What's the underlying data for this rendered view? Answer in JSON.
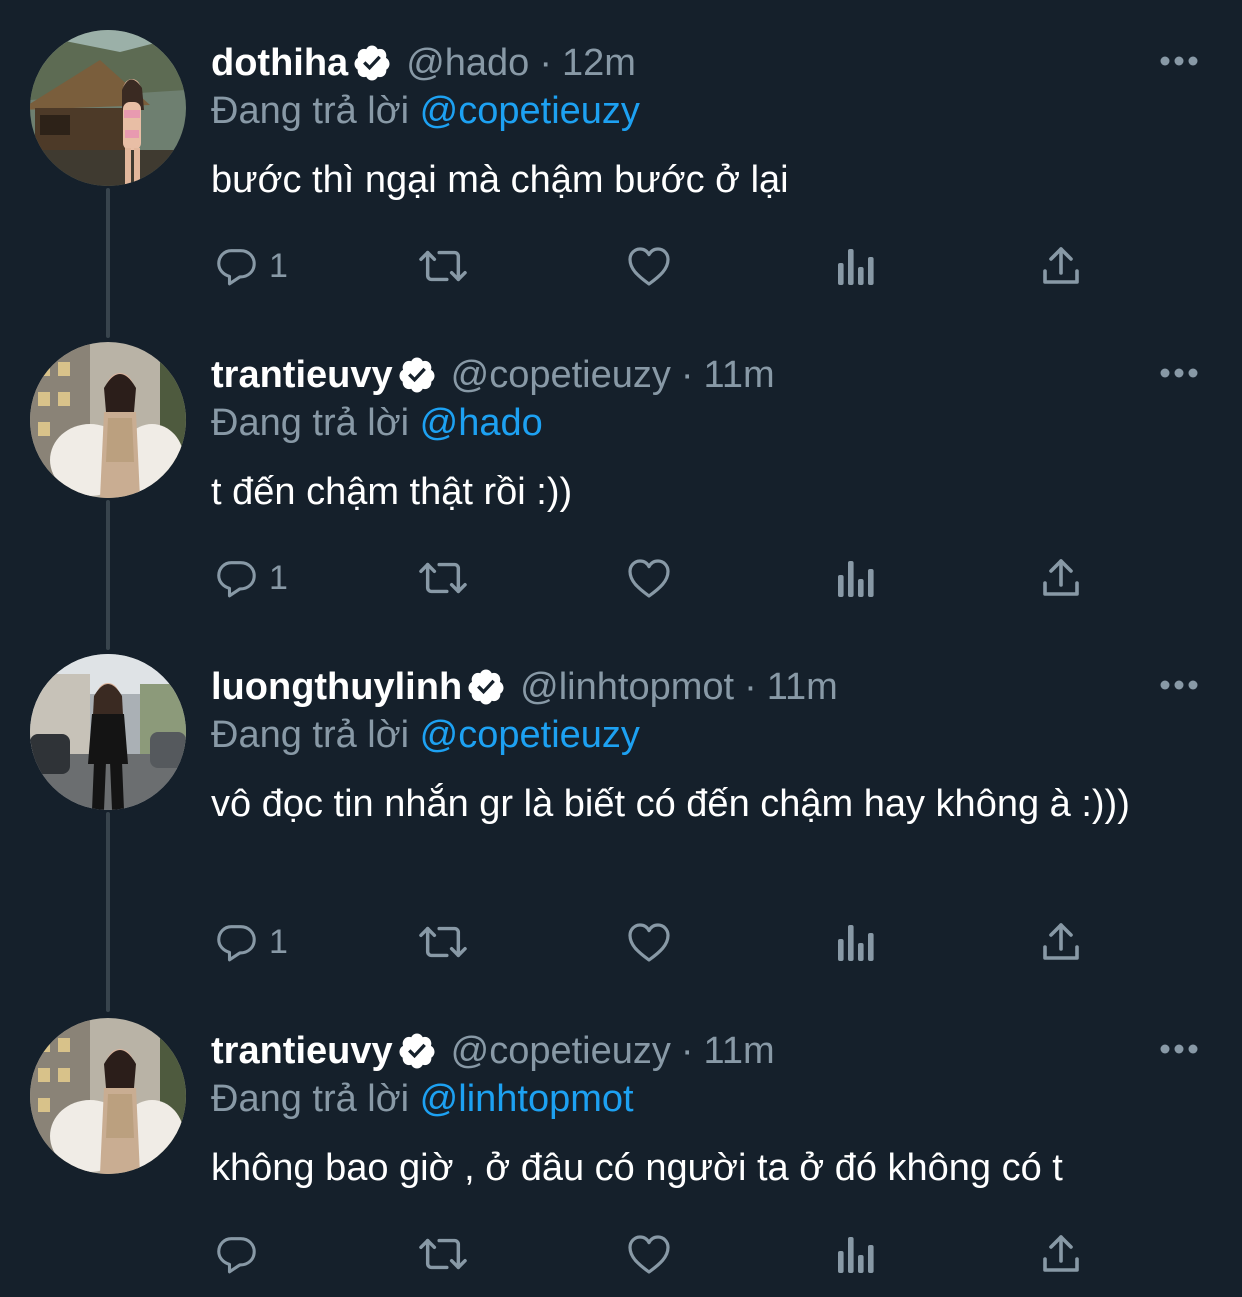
{
  "colors": {
    "background": "#15202b",
    "text_primary": "#ffffff",
    "text_secondary": "#8899a6",
    "link": "#1da1f2",
    "thread_line": "#38444d",
    "icon": "#8899a6"
  },
  "tweets": [
    {
      "display_name": "dothiha",
      "verified": true,
      "handle": "@hado",
      "separator": "·",
      "time": "12m",
      "replying_label": "Đang trả lời",
      "replying_to": "@copetieuzy",
      "text": "bước thì ngại mà chậm bước ở lại",
      "reply_count": "1",
      "icons": [
        "reply-icon",
        "retweet-icon",
        "like-icon",
        "views-icon",
        "share-icon",
        "more-icon",
        "verified-badge-icon"
      ]
    },
    {
      "display_name": "trantieuvy",
      "verified": true,
      "handle": "@copetieuzy",
      "separator": "·",
      "time": "11m",
      "replying_label": "Đang trả lời",
      "replying_to": "@hado",
      "text": "t đến chậm thật rồi :))",
      "reply_count": "1",
      "icons": [
        "reply-icon",
        "retweet-icon",
        "like-icon",
        "views-icon",
        "share-icon",
        "more-icon",
        "verified-badge-icon"
      ]
    },
    {
      "display_name": "luongthuylinh",
      "verified": true,
      "handle": "@linhtopmot",
      "separator": "·",
      "time": "11m",
      "replying_label": "Đang trả lời",
      "replying_to": "@copetieuzy",
      "text": "vô đọc tin nhắn gr là biết có đến chậm hay không à :)))",
      "reply_count": "1",
      "icons": [
        "reply-icon",
        "retweet-icon",
        "like-icon",
        "views-icon",
        "share-icon",
        "more-icon",
        "verified-badge-icon"
      ]
    },
    {
      "display_name": "trantieuvy",
      "verified": true,
      "handle": "@copetieuzy",
      "separator": "·",
      "time": "11m",
      "replying_label": "Đang trả lời",
      "replying_to": "@linhtopmot",
      "text": "không bao giờ , ở đâu có người ta ở đó không có t",
      "reply_count": "",
      "icons": [
        "reply-icon",
        "retweet-icon",
        "like-icon",
        "views-icon",
        "share-icon",
        "more-icon",
        "verified-badge-icon"
      ]
    }
  ]
}
